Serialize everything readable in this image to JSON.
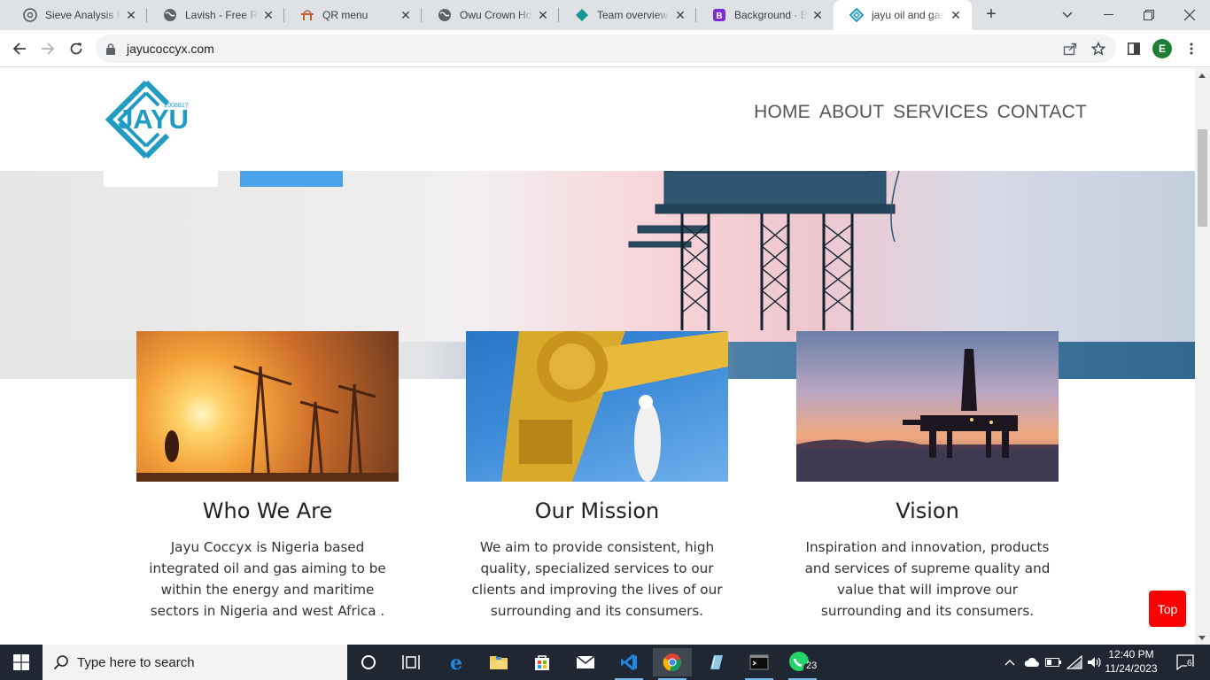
{
  "browser": {
    "tabs": [
      {
        "title": "Sieve Analysis Ex",
        "icon": "chatgpt-icon",
        "active": false
      },
      {
        "title": "Lavish - Free Res",
        "icon": "globe-icon",
        "active": false
      },
      {
        "title": "QR menu",
        "icon": "qr-menu-icon",
        "active": false
      },
      {
        "title": "Owu Crown Hotel",
        "icon": "globe-icon",
        "active": false
      },
      {
        "title": "Team overview |",
        "icon": "diamond-icon",
        "active": false
      },
      {
        "title": "Background · Bo",
        "icon": "bootstrap-icon",
        "active": false
      },
      {
        "title": "jayu oil and gas",
        "icon": "jayu-logo-icon",
        "active": true
      }
    ],
    "url": "jayucoccyx.com",
    "profile_initial": "E"
  },
  "site": {
    "logo_text": "JAYU",
    "logo_subtext": "2008817",
    "nav": [
      "HOME",
      "ABOUT",
      "SERVICES",
      "CONTACT"
    ],
    "cards": [
      {
        "title": "Who We Are",
        "image": "oil-pumpjacks-sunset",
        "text": "Jayu Coccyx is Nigeria based integrated oil and gas aiming to be within the energy and maritime sectors in Nigeria and west Africa ."
      },
      {
        "title": "Our Mission",
        "image": "yellow-pipeline-worker",
        "text": "We aim to provide consistent, high quality, specialized services to our clients and improving the lives of our surrounding and its consumers."
      },
      {
        "title": "Vision",
        "image": "offshore-rig-sunset",
        "text": "Inspiration and innovation, products and services of supreme quality and value that will improve our surrounding and its consumers."
      }
    ],
    "top_button": "Top"
  },
  "taskbar": {
    "search_placeholder": "Type here to search",
    "apps": [
      "cortana-icon",
      "task-view-icon",
      "edge-icon",
      "file-explorer-icon",
      "store-icon",
      "mail-icon",
      "vscode-icon",
      "chrome-icon",
      "notepad-icon",
      "terminal-icon",
      "whatsapp-icon"
    ],
    "whatsapp_badge": "23",
    "time": "12:40 PM",
    "date": "11/24/2023",
    "notification_count": "6"
  },
  "colors": {
    "accent_blue": "#4aa3e8",
    "logo_teal": "#1f9bc4",
    "top_button_red": "#ff0000",
    "taskbar": "#202733"
  }
}
